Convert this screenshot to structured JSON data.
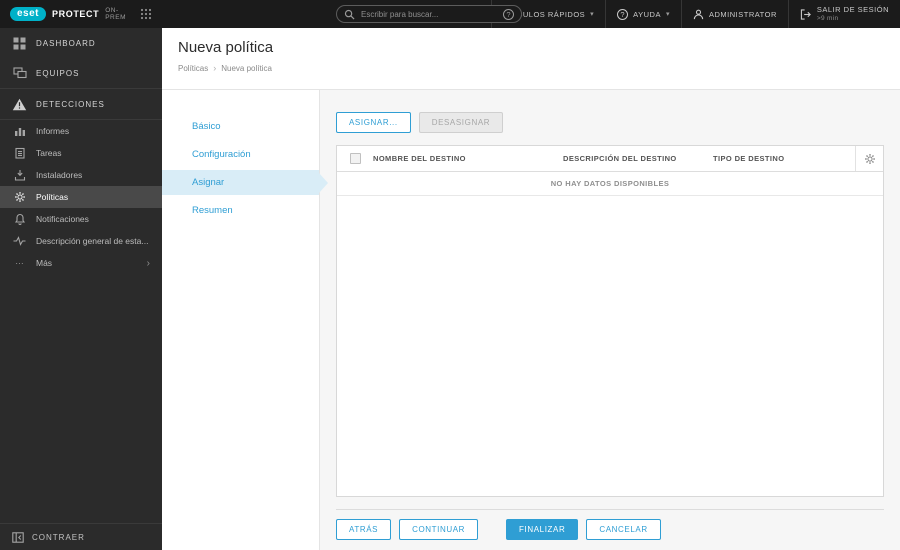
{
  "topbar": {
    "logo": "eset",
    "product": "PROTECT",
    "edition": "ON-PREM",
    "search_placeholder": "Escribir para buscar...",
    "quick_links_label": "VÍNCULOS RÁPIDOS",
    "help_label": "AYUDA",
    "user_label": "ADMINISTRATOR",
    "logout_label": "SALIR DE SESIÓN",
    "logout_timer": ">9 min"
  },
  "sidebar": {
    "items": [
      "DASHBOARD",
      "EQUIPOS",
      "DETECCIONES",
      "Informes",
      "Tareas",
      "Instaladores",
      "Políticas",
      "Notificaciones",
      "Descripción general de esta...",
      "Más"
    ],
    "selected_item": "Políticas",
    "collapse_label": "CONTRAER"
  },
  "page": {
    "title": "Nueva política",
    "breadcrumb_parent": "Políticas",
    "breadcrumb_current": "Nueva política"
  },
  "steps": {
    "items": [
      "Básico",
      "Configuración",
      "Asignar",
      "Resumen"
    ],
    "selected": "Asignar"
  },
  "toolbar": {
    "assign_label": "ASIGNAR...",
    "unassign_label": "DESASIGNAR"
  },
  "table": {
    "columns": [
      "NOMBRE DEL DESTINO",
      "DESCRIPCIÓN DEL DESTINO",
      "TIPO DE DESTINO"
    ],
    "empty_message": "NO HAY DATOS DISPONIBLES"
  },
  "footer": {
    "back_label": "ATRÁS",
    "continue_label": "CONTINUAR",
    "finish_label": "FINALIZAR",
    "cancel_label": "CANCELAR"
  },
  "glyphs": {
    "chevron_down": "▾",
    "chevron_right": "›",
    "breadcrumb_separator": "›",
    "question_mark": "?",
    "ellipsis": "···"
  },
  "colors": {
    "accent_blue": "#2f9ed4",
    "selected_step_bg": "#d9edf7",
    "brand_cyan": "#00b1c8",
    "topbar_bg": "#1b1b1b",
    "sidebar_bg": "#2b2b2b"
  }
}
